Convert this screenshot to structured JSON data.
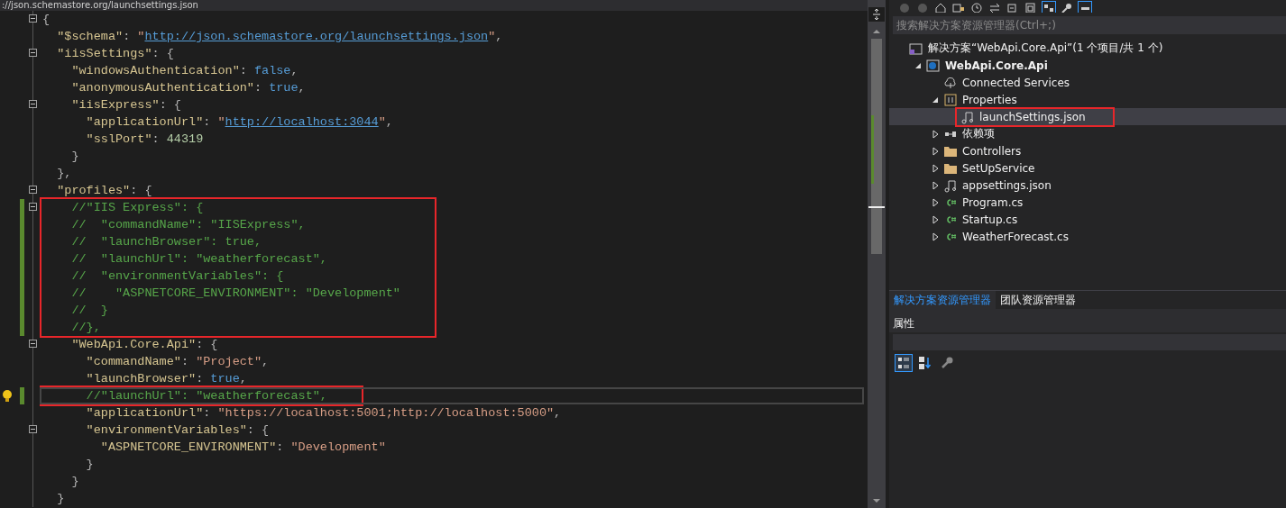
{
  "editor": {
    "nav_path": "://json.schemastore.org/launchsettings.json",
    "blocks": [
      {
        "boxed": false,
        "lines": [
          {
            "fold": true,
            "changed": false,
            "current": false,
            "lightbulb": false,
            "tokens": [
              {
                "kind": "punct",
                "text": "{"
              }
            ]
          },
          {
            "fold": false,
            "changed": false,
            "current": false,
            "lightbulb": false,
            "tokens": [
              {
                "kind": "key",
                "text": "  \"$schema\""
              },
              {
                "kind": "punct",
                "text": ": "
              },
              {
                "kind": "string",
                "text": "\""
              },
              {
                "kind": "url",
                "text": "http://json.schemastore.org/launchsettings.json"
              },
              {
                "kind": "string",
                "text": "\""
              },
              {
                "kind": "punct",
                "text": ","
              }
            ]
          },
          {
            "fold": true,
            "changed": false,
            "current": false,
            "lightbulb": false,
            "tokens": [
              {
                "kind": "key",
                "text": "  \"iisSettings\""
              },
              {
                "kind": "punct",
                "text": ": {"
              }
            ]
          },
          {
            "fold": false,
            "changed": false,
            "current": false,
            "lightbulb": false,
            "tokens": [
              {
                "kind": "key",
                "text": "    \"windowsAuthentication\""
              },
              {
                "kind": "punct",
                "text": ": "
              },
              {
                "kind": "keyword",
                "text": "false"
              },
              {
                "kind": "punct",
                "text": ","
              }
            ]
          },
          {
            "fold": false,
            "changed": false,
            "current": false,
            "lightbulb": false,
            "tokens": [
              {
                "kind": "key",
                "text": "    \"anonymousAuthentication\""
              },
              {
                "kind": "punct",
                "text": ": "
              },
              {
                "kind": "keyword",
                "text": "true"
              },
              {
                "kind": "punct",
                "text": ","
              }
            ]
          },
          {
            "fold": true,
            "changed": false,
            "current": false,
            "lightbulb": false,
            "tokens": [
              {
                "kind": "key",
                "text": "    \"iisExpress\""
              },
              {
                "kind": "punct",
                "text": ": {"
              }
            ]
          },
          {
            "fold": false,
            "changed": false,
            "current": false,
            "lightbulb": false,
            "tokens": [
              {
                "kind": "key",
                "text": "      \"applicationUrl\""
              },
              {
                "kind": "punct",
                "text": ": "
              },
              {
                "kind": "string",
                "text": "\""
              },
              {
                "kind": "url",
                "text": "http://localhost:3044"
              },
              {
                "kind": "string",
                "text": "\""
              },
              {
                "kind": "punct",
                "text": ","
              }
            ]
          },
          {
            "fold": false,
            "changed": false,
            "current": false,
            "lightbulb": false,
            "tokens": [
              {
                "kind": "key",
                "text": "      \"sslPort\""
              },
              {
                "kind": "punct",
                "text": ": "
              },
              {
                "kind": "number",
                "text": "44319"
              }
            ]
          },
          {
            "fold": false,
            "changed": false,
            "current": false,
            "lightbulb": false,
            "tokens": [
              {
                "kind": "punct",
                "text": "    }"
              }
            ]
          },
          {
            "fold": false,
            "changed": false,
            "current": false,
            "lightbulb": false,
            "tokens": [
              {
                "kind": "punct",
                "text": "  },"
              }
            ]
          },
          {
            "fold": true,
            "changed": false,
            "current": false,
            "lightbulb": false,
            "tokens": [
              {
                "kind": "key",
                "text": "  \"profiles\""
              },
              {
                "kind": "punct",
                "text": ": {"
              }
            ]
          }
        ]
      },
      {
        "boxed": true,
        "lines": [
          {
            "fold": true,
            "changed": true,
            "current": false,
            "lightbulb": false,
            "tokens": [
              {
                "kind": "comment",
                "text": "    //\"IIS Express\": {"
              }
            ]
          },
          {
            "fold": false,
            "changed": true,
            "current": false,
            "lightbulb": false,
            "tokens": [
              {
                "kind": "comment",
                "text": "    //  \"commandName\": \"IISExpress\","
              }
            ]
          },
          {
            "fold": false,
            "changed": true,
            "current": false,
            "lightbulb": false,
            "tokens": [
              {
                "kind": "comment",
                "text": "    //  \"launchBrowser\": true,"
              }
            ]
          },
          {
            "fold": false,
            "changed": true,
            "current": false,
            "lightbulb": false,
            "tokens": [
              {
                "kind": "comment",
                "text": "    //  \"launchUrl\": \"weatherforecast\","
              }
            ]
          },
          {
            "fold": false,
            "changed": true,
            "current": false,
            "lightbulb": false,
            "tokens": [
              {
                "kind": "comment",
                "text": "    //  \"environmentVariables\": {"
              }
            ]
          },
          {
            "fold": false,
            "changed": true,
            "current": false,
            "lightbulb": false,
            "tokens": [
              {
                "kind": "comment",
                "text": "    //    \"ASPNETCORE_ENVIRONMENT\": \"Development\""
              }
            ]
          },
          {
            "fold": false,
            "changed": true,
            "current": false,
            "lightbulb": false,
            "tokens": [
              {
                "kind": "comment",
                "text": "    //  }"
              }
            ]
          },
          {
            "fold": false,
            "changed": true,
            "current": false,
            "lightbulb": false,
            "tokens": [
              {
                "kind": "comment",
                "text": "    //},"
              }
            ]
          }
        ]
      },
      {
        "boxed": false,
        "lines": [
          {
            "fold": true,
            "changed": false,
            "current": false,
            "lightbulb": false,
            "tokens": [
              {
                "kind": "key",
                "text": "    \"WebApi.Core.Api\""
              },
              {
                "kind": "punct",
                "text": ": {"
              }
            ]
          },
          {
            "fold": false,
            "changed": false,
            "current": false,
            "lightbulb": false,
            "tokens": [
              {
                "kind": "key",
                "text": "      \"commandName\""
              },
              {
                "kind": "punct",
                "text": ": "
              },
              {
                "kind": "string",
                "text": "\"Project\""
              },
              {
                "kind": "punct",
                "text": ","
              }
            ]
          },
          {
            "fold": false,
            "changed": false,
            "current": false,
            "lightbulb": false,
            "tokens": [
              {
                "kind": "key",
                "text": "      \"launchBrowser\""
              },
              {
                "kind": "punct",
                "text": ": "
              },
              {
                "kind": "keyword",
                "text": "true"
              },
              {
                "kind": "punct",
                "text": ","
              }
            ]
          }
        ]
      },
      {
        "boxed": true,
        "lines": [
          {
            "fold": false,
            "changed": true,
            "current": true,
            "lightbulb": true,
            "tokens": [
              {
                "kind": "comment",
                "text": "      //\"launchUrl\": \"weatherforecast\","
              }
            ]
          }
        ]
      },
      {
        "boxed": false,
        "lines": [
          {
            "fold": false,
            "changed": false,
            "current": false,
            "lightbulb": false,
            "tokens": [
              {
                "kind": "key",
                "text": "      \"applicationUrl\""
              },
              {
                "kind": "punct",
                "text": ": "
              },
              {
                "kind": "string",
                "text": "\"https://localhost:5001;http://localhost:5000\""
              },
              {
                "kind": "punct",
                "text": ","
              }
            ]
          },
          {
            "fold": true,
            "changed": false,
            "current": false,
            "lightbulb": false,
            "tokens": [
              {
                "kind": "key",
                "text": "      \"environmentVariables\""
              },
              {
                "kind": "punct",
                "text": ": {"
              }
            ]
          },
          {
            "fold": false,
            "changed": false,
            "current": false,
            "lightbulb": false,
            "tokens": [
              {
                "kind": "key",
                "text": "        \"ASPNETCORE_ENVIRONMENT\""
              },
              {
                "kind": "punct",
                "text": ": "
              },
              {
                "kind": "string",
                "text": "\"Development\""
              }
            ]
          },
          {
            "fold": false,
            "changed": false,
            "current": false,
            "lightbulb": false,
            "tokens": [
              {
                "kind": "punct",
                "text": "      }"
              }
            ]
          },
          {
            "fold": false,
            "changed": false,
            "current": false,
            "lightbulb": false,
            "tokens": [
              {
                "kind": "punct",
                "text": "    }"
              }
            ]
          },
          {
            "fold": false,
            "changed": false,
            "current": false,
            "lightbulb": false,
            "tokens": [
              {
                "kind": "punct",
                "text": "  }"
              }
            ]
          }
        ]
      }
    ]
  },
  "solution_explorer": {
    "search": {
      "placeholder": "搜索解决方案资源管理器(Ctrl+;)"
    },
    "tree": [
      {
        "label": "解决方案“WebApi.Core.Api”(1 个项目/共 1 个)",
        "kind": "solution",
        "selected": false,
        "boxed": false,
        "children": [
          {
            "label": "WebApi.Core.Api",
            "kind": "project",
            "expanded": true,
            "selected": false,
            "boxed": false,
            "children": [
              {
                "label": "Connected Services",
                "kind": "connected",
                "selected": false,
                "boxed": false
              },
              {
                "label": "Properties",
                "kind": "properties",
                "expanded": true,
                "selected": false,
                "boxed": false,
                "children": [
                  {
                    "label": "launchSettings.json",
                    "kind": "json",
                    "selected": true,
                    "boxed": true
                  }
                ]
              },
              {
                "label": "依赖项",
                "kind": "dependencies",
                "expanded": false,
                "selected": false,
                "boxed": false
              },
              {
                "label": "Controllers",
                "kind": "folder",
                "expanded": false,
                "selected": false,
                "boxed": false
              },
              {
                "label": "SetUpService",
                "kind": "folder",
                "expanded": false,
                "selected": false,
                "boxed": false
              },
              {
                "label": "appsettings.json",
                "kind": "json",
                "expanded": false,
                "selected": false,
                "boxed": false
              },
              {
                "label": "Program.cs",
                "kind": "csharp",
                "expanded": false,
                "selected": false,
                "boxed": false
              },
              {
                "label": "Startup.cs",
                "kind": "csharp",
                "expanded": false,
                "selected": false,
                "boxed": false
              },
              {
                "label": "WeatherForecast.cs",
                "kind": "csharp",
                "expanded": false,
                "selected": false,
                "boxed": false
              }
            ]
          }
        ]
      }
    ],
    "tabs": [
      {
        "label": "解决方案资源管理器",
        "selected": true
      },
      {
        "label": "团队资源管理器",
        "selected": false
      }
    ]
  },
  "properties": {
    "title": "属性",
    "tools": [
      {
        "kind": "categorized",
        "selected": true
      },
      {
        "kind": "alphabetical",
        "selected": false
      },
      {
        "kind": "pages",
        "selected": false
      }
    ]
  }
}
